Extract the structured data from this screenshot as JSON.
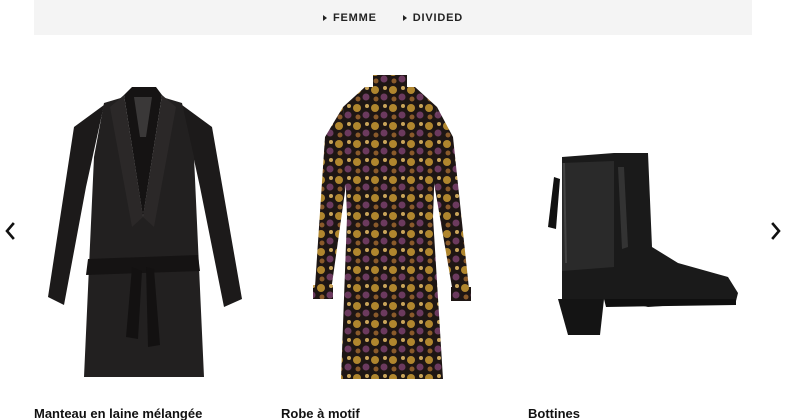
{
  "nav": {
    "links": [
      {
        "label": "FEMME"
      },
      {
        "label": "DIVIDED"
      }
    ]
  },
  "carousel": {
    "prev_icon": "chevron-left-icon",
    "next_icon": "chevron-right-icon",
    "products": [
      {
        "name": "Manteau en laine mélangée"
      },
      {
        "name": "Robe à motif"
      },
      {
        "name": "Bottines"
      }
    ]
  }
}
